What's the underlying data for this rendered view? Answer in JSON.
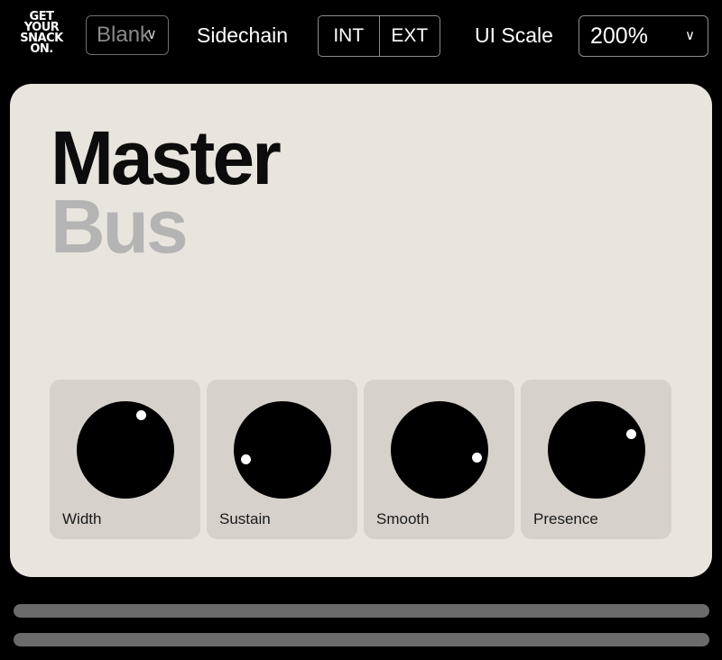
{
  "topbar": {
    "logo_lines": [
      "GET",
      "YOUR",
      "SNACK",
      "ON."
    ],
    "preset": {
      "value": "Blank",
      "icon": "chevron-down-icon"
    },
    "sidechain_label": "Sidechain",
    "sidechain_options": [
      "INT",
      "EXT"
    ],
    "ui_scale_label": "UI Scale",
    "ui_scale": {
      "value": "200%",
      "icon": "chevron-down-icon"
    }
  },
  "panel": {
    "title_primary": "Master",
    "title_secondary": "Bus",
    "knobs": [
      {
        "label": "Width",
        "value": 0.58
      },
      {
        "label": "Sustain",
        "value": 0.15
      },
      {
        "label": "Smooth",
        "value": 0.84
      },
      {
        "label": "Presence",
        "value": 0.72
      }
    ]
  },
  "colors": {
    "background": "#000000",
    "panel": "#e8e5de",
    "knob_card": "#d6d2cb",
    "title_primary": "#0c0c0c",
    "title_secondary": "#b4b4b4",
    "scrollbar": "#6b6b6b"
  }
}
